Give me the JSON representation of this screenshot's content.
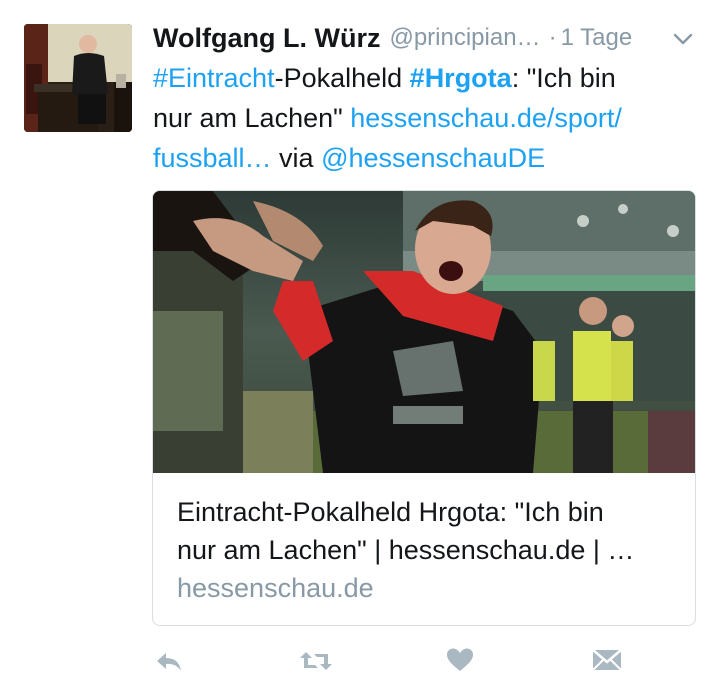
{
  "tweet": {
    "author_name": "Wolfgang L. Würz",
    "handle": "@principian…",
    "separator": "·",
    "time": "1 Tage",
    "line1": {
      "tag1": "#Eintracht",
      "text1": "-Pokalheld ",
      "tag2": "#Hrgota",
      "text2": ": \"Ich bin"
    },
    "line2": {
      "text": "nur am Lachen\" ",
      "link": "hessenschau.de/sport/"
    },
    "line3": {
      "link": "fussball…",
      "text": " via ",
      "mention": "@hessenschauDE"
    }
  },
  "card": {
    "title_line1": "Eintracht-Pokalheld Hrgota: \"Ich bin",
    "title_line2": "nur am Lachen\" | hessenschau.de | …",
    "domain": "hessenschau.de"
  },
  "actions": [
    "reply-icon",
    "retweet-icon",
    "like-icon",
    "direct-message-icon"
  ],
  "colors": {
    "link": "#1da1f2",
    "muted": "#8899a6",
    "action_icon": "#aab8c2",
    "jersey_red": "#d42a2a"
  }
}
